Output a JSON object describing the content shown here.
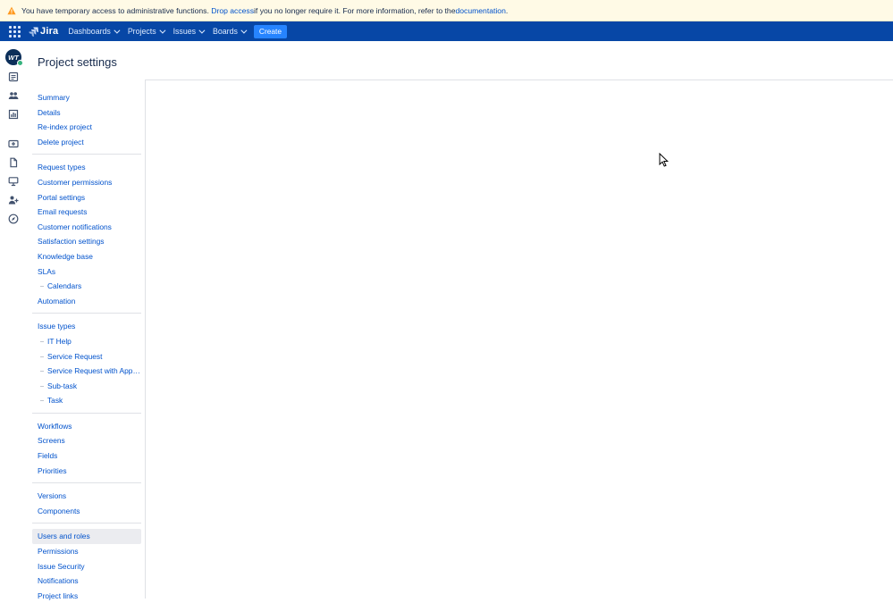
{
  "banner": {
    "text_before": "You have temporary access to administrative functions. ",
    "drop_access": "Drop access",
    "text_middle": " if you no longer require it. For more information, refer to the ",
    "documentation": "documentation",
    "text_after": ".",
    "icon": "warning-icon"
  },
  "topnav": {
    "logo": "Jira",
    "items": [
      "Dashboards",
      "Projects",
      "Issues",
      "Boards"
    ],
    "create": "Create"
  },
  "rail": {
    "avatar_initials": "WT",
    "icons": [
      "queue-icon",
      "customers-icon",
      "reports-icon",
      "raise-request-icon",
      "knowledge-icon",
      "channels-icon",
      "add-people-icon",
      "compass-icon"
    ]
  },
  "page": {
    "title": "Project settings"
  },
  "sidebar": {
    "groups": [
      [
        {
          "label": "Summary"
        },
        {
          "label": "Details"
        },
        {
          "label": "Re-index project"
        },
        {
          "label": "Delete project"
        }
      ],
      [
        {
          "label": "Request types"
        },
        {
          "label": "Customer permissions"
        },
        {
          "label": "Portal settings"
        },
        {
          "label": "Email requests"
        },
        {
          "label": "Customer notifications"
        },
        {
          "label": "Satisfaction settings"
        },
        {
          "label": "Knowledge base"
        },
        {
          "label": "SLAs"
        },
        {
          "label": "Calendars",
          "sub": true
        },
        {
          "label": "Automation"
        }
      ],
      [
        {
          "label": "Issue types"
        },
        {
          "label": "IT Help",
          "sub": true
        },
        {
          "label": "Service Request",
          "sub": true
        },
        {
          "label": "Service Request with Appro...",
          "sub": true
        },
        {
          "label": "Sub-task",
          "sub": true
        },
        {
          "label": "Task",
          "sub": true
        }
      ],
      [
        {
          "label": "Workflows"
        },
        {
          "label": "Screens"
        },
        {
          "label": "Fields"
        },
        {
          "label": "Priorities"
        }
      ],
      [
        {
          "label": "Versions"
        },
        {
          "label": "Components"
        }
      ],
      [
        {
          "label": "Users and roles",
          "active": true
        },
        {
          "label": "Permissions"
        },
        {
          "label": "Issue Security"
        },
        {
          "label": "Notifications"
        },
        {
          "label": "Project links"
        }
      ]
    ]
  },
  "colors": {
    "nav": "#0747a6",
    "link": "#0052cc",
    "create": "#2684ff",
    "banner": "#fffae6"
  }
}
